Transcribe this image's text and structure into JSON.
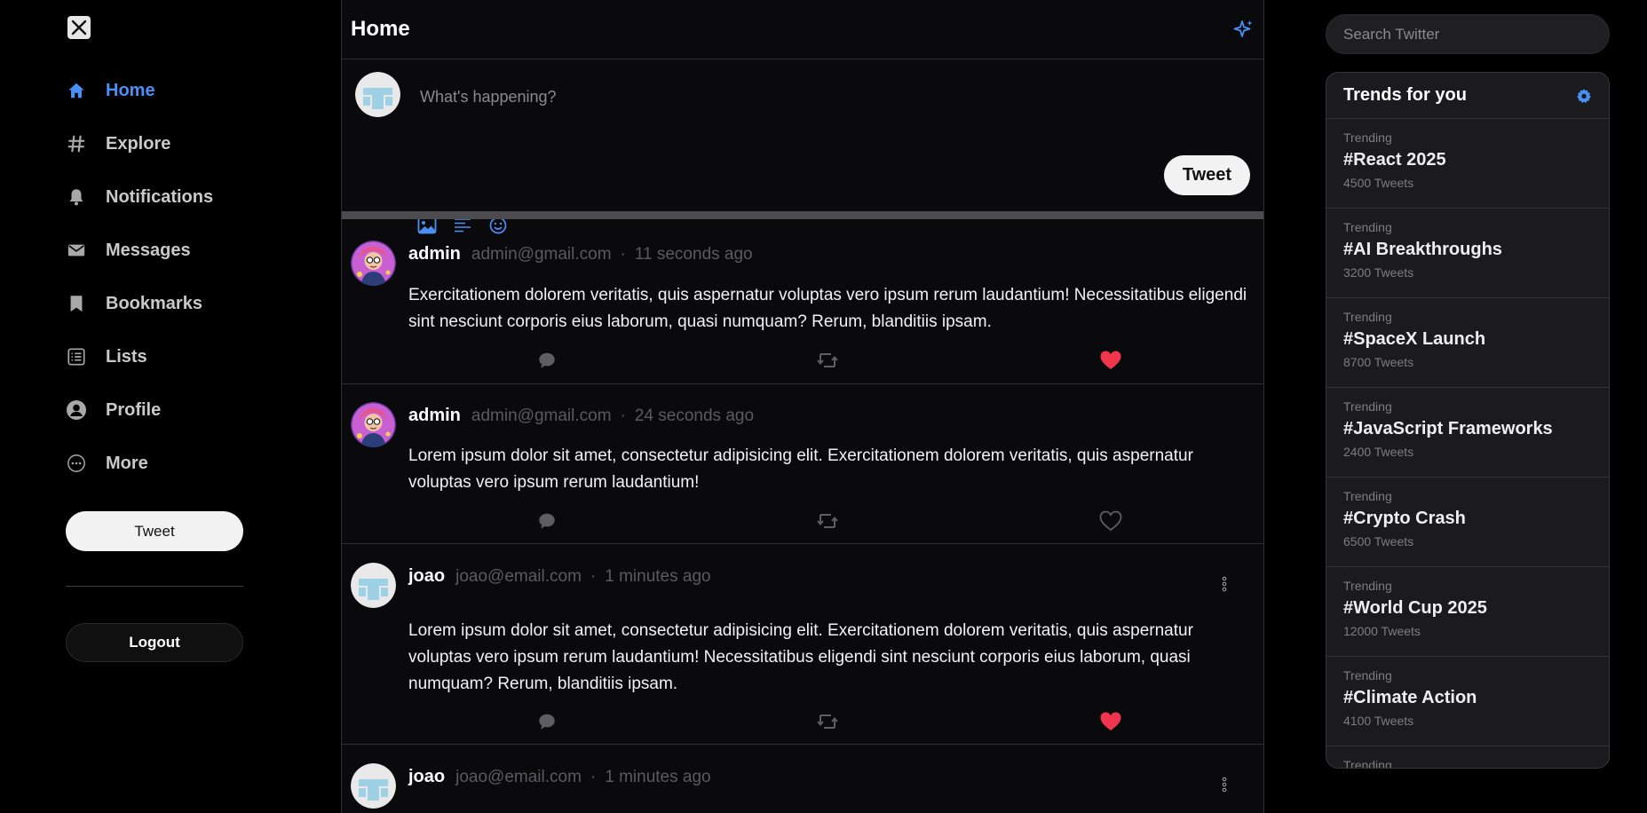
{
  "colors": {
    "accent": "#4a8ff5",
    "like_active": "#f0364d",
    "background": "#000000",
    "panel": "#1b1b1d"
  },
  "sidebar": {
    "logo_icon": "x-logo-icon",
    "items": [
      {
        "label": "Home",
        "icon": "home-icon",
        "active": true
      },
      {
        "label": "Explore",
        "icon": "hashtag-icon"
      },
      {
        "label": "Notifications",
        "icon": "bell-icon"
      },
      {
        "label": "Messages",
        "icon": "envelope-icon"
      },
      {
        "label": "Bookmarks",
        "icon": "bookmark-icon"
      },
      {
        "label": "Lists",
        "icon": "list-icon"
      },
      {
        "label": "Profile",
        "icon": "user-circle-icon"
      },
      {
        "label": "More",
        "icon": "more-circle-icon"
      }
    ],
    "tweet_button": "Tweet",
    "logout_button": "Logout"
  },
  "main": {
    "title": "Home",
    "sparkle_icon": "sparkle-icon",
    "composer": {
      "placeholder": "What's happening?",
      "tools": [
        "image-icon",
        "text-align-icon",
        "emoji-icon"
      ],
      "tweet_button": "Tweet"
    },
    "posts": [
      {
        "name": "admin",
        "handle": "admin@gmail.com",
        "dot": "·",
        "time": "11 seconds ago",
        "body": "Exercitationem dolorem veritatis, quis aspernatur voluptas vero ipsum rerum laudantium! Necessitatibus eligendi sint nesciunt corporis eius laborum, quasi numquam? Rerum, blanditiis ipsam.",
        "liked": true,
        "avatar": "cartoon-avatar"
      },
      {
        "name": "admin",
        "handle": "admin@gmail.com",
        "dot": "·",
        "time": "24 seconds ago",
        "body": "Lorem ipsum dolor sit amet, consectetur adipisicing elit. Exercitationem dolorem veritatis, quis aspernatur voluptas vero ipsum rerum laudantium!",
        "liked": false,
        "avatar": "cartoon-avatar"
      },
      {
        "name": "joao",
        "handle": "joao@email.com",
        "dot": "·",
        "time": "1 minutes ago",
        "body": "Lorem ipsum dolor sit amet, consectetur adipisicing elit. Exercitationem dolorem veritatis, quis aspernatur voluptas vero ipsum rerum laudantium! Necessitatibus eligendi sint nesciunt corporis eius laborum, quasi numquam? Rerum, blanditiis ipsam.",
        "liked": true,
        "avatar": "default-avatar"
      },
      {
        "name": "joao",
        "handle": "joao@email.com",
        "dot": "·",
        "time": "1 minutes ago",
        "body": "",
        "liked": false,
        "avatar": "default-avatar"
      }
    ]
  },
  "right": {
    "search_placeholder": "Search Twitter",
    "trends_title": "Trends for you",
    "settings_icon": "gear-icon",
    "trends": [
      {
        "category": "Trending",
        "name": "#React 2025",
        "count": "4500 Tweets"
      },
      {
        "category": "Trending",
        "name": "#AI Breakthroughs",
        "count": "3200 Tweets"
      },
      {
        "category": "Trending",
        "name": "#SpaceX Launch",
        "count": "8700 Tweets"
      },
      {
        "category": "Trending",
        "name": "#JavaScript Frameworks",
        "count": "2400 Tweets"
      },
      {
        "category": "Trending",
        "name": "#Crypto Crash",
        "count": "6500 Tweets"
      },
      {
        "category": "Trending",
        "name": "#World Cup 2025",
        "count": "12000 Tweets"
      },
      {
        "category": "Trending",
        "name": "#Climate Action",
        "count": "4100 Tweets"
      },
      {
        "category": "Trending",
        "name": "",
        "count": ""
      }
    ]
  }
}
